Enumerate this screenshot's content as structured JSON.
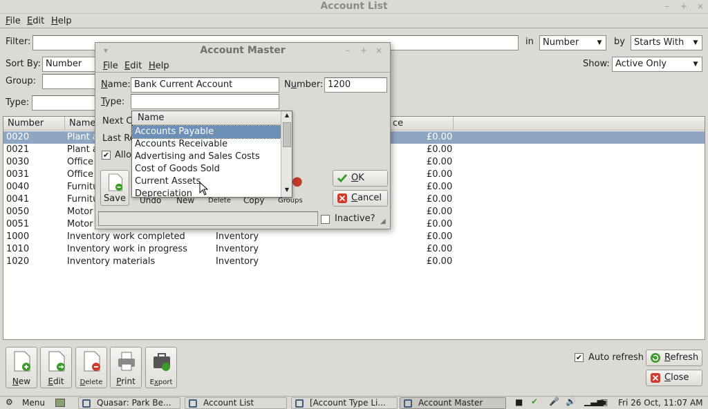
{
  "main": {
    "title": "Account List",
    "menu": [
      "File",
      "Edit",
      "Help"
    ],
    "filter_label": "Filter:",
    "filter_value": "",
    "in_label": "in",
    "in_value": "Number",
    "by_label": "by",
    "by_value": "Starts With",
    "sortby_label": "Sort By:",
    "sortby_value": "Number",
    "show_label": "Show:",
    "show_value": "Active Only",
    "group_label": "Group:",
    "type_label": "Type:",
    "columns": [
      "Number",
      "Name",
      "ce"
    ],
    "rows": [
      {
        "number": "0020",
        "name": "Plant a",
        "type": "",
        "balance": "£0.00"
      },
      {
        "number": "0021",
        "name": "Plant a",
        "type": "",
        "balance": "£0.00"
      },
      {
        "number": "0030",
        "name": "Office",
        "type": "",
        "balance": "£0.00"
      },
      {
        "number": "0031",
        "name": "Office",
        "type": "",
        "balance": "£0.00"
      },
      {
        "number": "0040",
        "name": "Furnitu",
        "type": "",
        "balance": "£0.00"
      },
      {
        "number": "0041",
        "name": "Furnitu",
        "type": "",
        "balance": "£0.00"
      },
      {
        "number": "0050",
        "name": "Motor V",
        "type": "",
        "balance": "£0.00"
      },
      {
        "number": "0051",
        "name": "Motor V",
        "type": "",
        "balance": "£0.00"
      },
      {
        "number": "1000",
        "name": "Inventory work completed",
        "type": "Inventory",
        "balance": "£0.00"
      },
      {
        "number": "1010",
        "name": "Inventory work in progress",
        "type": "Inventory",
        "balance": "£0.00"
      },
      {
        "number": "1020",
        "name": "Inventory materials",
        "type": "Inventory",
        "balance": "£0.00"
      }
    ],
    "buttons": {
      "new": "New",
      "edit": "Edit",
      "delete": "Delete",
      "print": "Print",
      "export": "Export"
    },
    "auto_refresh_label": "Auto refresh",
    "auto_refresh_checked": true,
    "refresh_label": "Refresh",
    "close_label": "Close"
  },
  "dialog": {
    "title": "Account Master",
    "menu": [
      "File",
      "Edit",
      "Help"
    ],
    "name_label": "Name:",
    "name_value": "Bank Current Account",
    "number_label": "Number:",
    "number_value": "1200",
    "type_label": "Type:",
    "type_value": "",
    "next_label": "Next C",
    "last_label": "Last Re",
    "allow_label": "Allov",
    "allow_checked": true,
    "tools": {
      "save": "Save",
      "undo": "Undo",
      "new": "New",
      "delete": "Delete",
      "copy": "Copy",
      "groups": "Groups"
    },
    "ok_label": "OK",
    "cancel_label": "Cancel",
    "inactive_label": "Inactive?",
    "inactive_checked": false
  },
  "type_popup": {
    "header": "Name",
    "items": [
      "Accounts Payable",
      "Accounts Receivable",
      "Advertising and Sales Costs",
      "Cost of Goods Sold",
      "Current Assets",
      "Depreciation"
    ],
    "selected_index": 0
  },
  "taskbar": {
    "menu_label": "Menu",
    "tasks": [
      "Quasar: Park Be...",
      "Account List",
      "[Account Type Li...",
      "Account Master"
    ],
    "active_task": 3,
    "clock": "Fri 26 Oct, 11:07 AM"
  },
  "colors": {
    "selection": "#8fa6c2",
    "popup_selection": "#6e8fb6",
    "window_bg": "#dcdad5"
  }
}
